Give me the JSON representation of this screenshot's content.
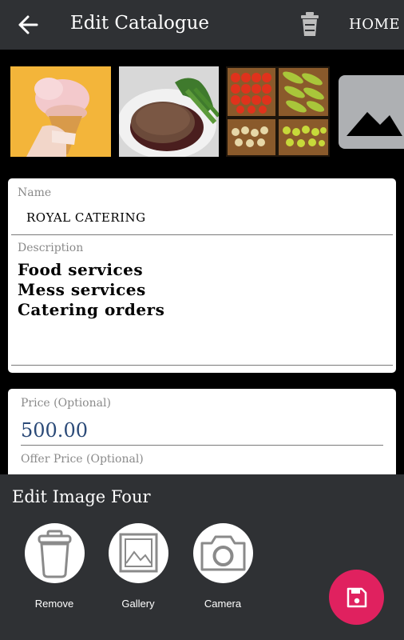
{
  "appbar": {
    "title": "Edit Catalogue",
    "home_label": "HOME"
  },
  "form": {
    "name_label": "Name",
    "name_value": "ROYAL CATERING",
    "description_label": "Description",
    "description_lines": [
      "Food services",
      "Mess services",
      "Catering orders"
    ],
    "price_label": "Price (Optional)",
    "price_value": "500.00",
    "offer_price_label": "Offer Price (Optional)"
  },
  "sheet": {
    "title": "Edit Image Four",
    "options": [
      {
        "label": "Remove",
        "icon": "trash-icon"
      },
      {
        "label": "Gallery",
        "icon": "gallery-icon"
      },
      {
        "label": "Camera",
        "icon": "camera-icon"
      }
    ]
  },
  "colors": {
    "appbar": "#2f3134",
    "accent": "#e0215f",
    "price_text": "#2b4a78"
  }
}
